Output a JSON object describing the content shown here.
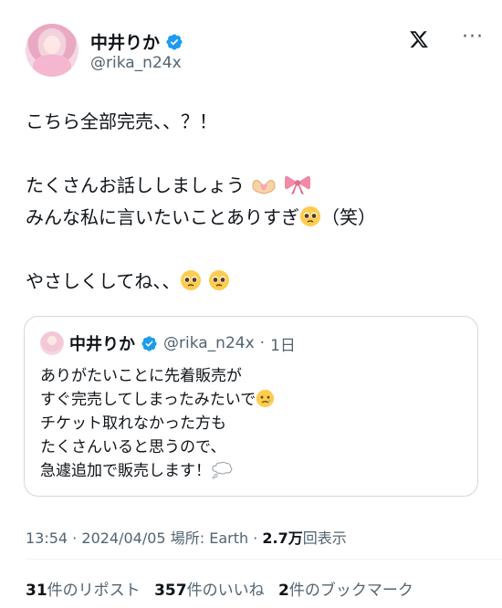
{
  "author": {
    "name": "中井りか",
    "handle": "@rika_n24x"
  },
  "tweet": {
    "lines": [
      "こちら全部完売、、？！",
      "",
      "たくさんお話ししましょう",
      "みんな私に言いたいことありすぎ",
      "",
      "やさしくしてね、、"
    ],
    "line4_suffix": "（笑）"
  },
  "quote": {
    "name": "中井りか",
    "handle": "@rika_n24x",
    "separator": "·",
    "age": "1日",
    "lines": [
      "ありがたいことに先着販売が",
      "すぐ完売してしまったみたいで",
      "チケット取れなかった方も",
      "たくさんいると思うので、",
      "急遽追加で販売します！"
    ]
  },
  "meta": {
    "time": "13:54",
    "dot1": "·",
    "date": "2024/04/05",
    "place_label": "場所:",
    "place": "Earth",
    "dot2": "·",
    "views_value": "2.7万",
    "views_label": "回表示"
  },
  "stats": {
    "reposts_value": "31",
    "reposts_label": "件のリポスト",
    "likes_value": "357",
    "likes_label": "件のいいね",
    "bookmarks_value": "2",
    "bookmarks_label": "件のブックマーク"
  },
  "icons": {
    "verified": "verified-badge-icon",
    "logo": "x-logo-icon",
    "more": "more-options-icon",
    "emoji_hands": "heart-hands-emoji",
    "emoji_ribbon": "ribbon-emoji",
    "emoji_pleading": "pleading-face-emoji",
    "emoji_tear": "face-holding-back-tears-emoji",
    "emoji_thought": "thought-balloon-emoji"
  },
  "colors": {
    "verified": "#1d9bf0",
    "text": "#0f1419",
    "secondary": "#536471"
  }
}
